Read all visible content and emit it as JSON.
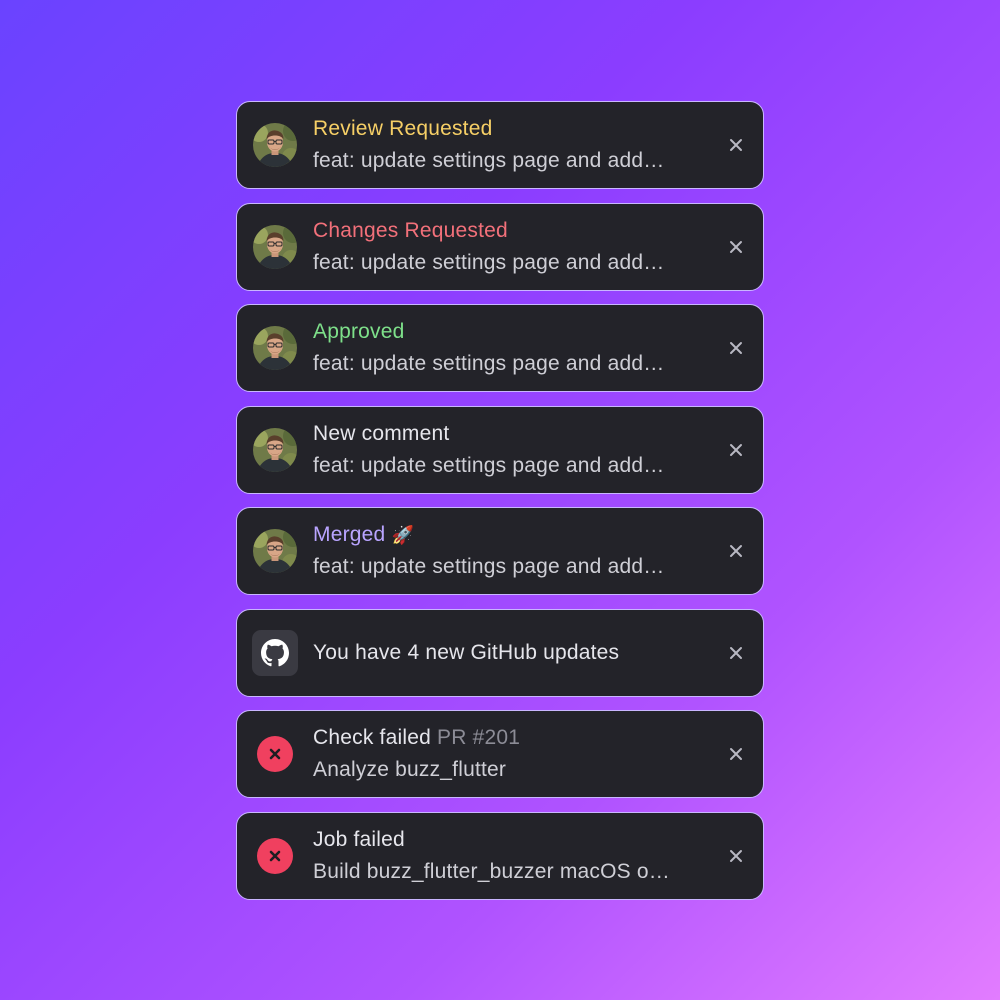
{
  "colors": {
    "review_requested": "#f6cf66",
    "changes_requested": "#f2707a",
    "approved": "#7ee08a",
    "new_comment": "#e6e6ec",
    "merged": "#b9a4ff",
    "error": "#f0405f",
    "card_bg": "#232329",
    "card_border": "#c9b6ff"
  },
  "notifications": [
    {
      "kind": "review_requested",
      "icon": "avatar",
      "title": "Review Requested",
      "subtitle": "feat: update settings page and add…"
    },
    {
      "kind": "changes_requested",
      "icon": "avatar",
      "title": "Changes Requested",
      "subtitle": "feat: update settings page and add…"
    },
    {
      "kind": "approved",
      "icon": "avatar",
      "title": "Approved",
      "subtitle": "feat: update settings page and add…"
    },
    {
      "kind": "new_comment",
      "icon": "avatar",
      "title": "New comment",
      "subtitle": "feat: update settings page and add…"
    },
    {
      "kind": "merged",
      "icon": "avatar",
      "title": "Merged",
      "emoji": "🚀",
      "subtitle": "feat: update settings page and add…"
    },
    {
      "kind": "github_updates",
      "icon": "github-icon",
      "message": "You have 4 new GitHub updates"
    },
    {
      "kind": "check_failed",
      "icon": "error-icon",
      "title": "Check failed",
      "meta": "PR #201",
      "subtitle": "Analyze buzz_flutter"
    },
    {
      "kind": "job_failed",
      "icon": "error-icon",
      "title": "Job failed",
      "subtitle": "Build buzz_flutter_buzzer macOS o…"
    }
  ]
}
